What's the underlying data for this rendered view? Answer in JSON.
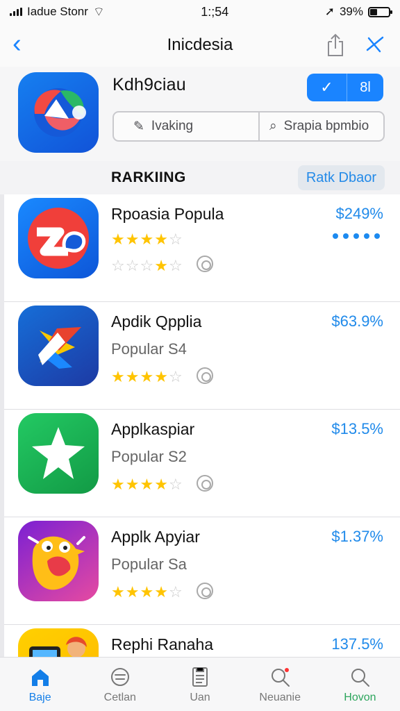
{
  "status": {
    "carrier": "Iadue Stonr",
    "time": "1:;54",
    "battery": "39%",
    "battery_level": 0.39
  },
  "nav": {
    "title": "Inicdesia",
    "back_icon": "back-chevron-icon",
    "share_icon": "share-icon",
    "close_icon": "close-icon"
  },
  "header": {
    "title": "Kdh9ciau",
    "action_count": "8l",
    "search_left": "Ivaking",
    "search_right": "Srapia bpmbio"
  },
  "section": {
    "title": "RARKIING",
    "rank_chip": "Ratk Dbaor"
  },
  "apps": [
    {
      "name": "Rpoasia Popula",
      "subtitle": "",
      "price": "$249%",
      "rating": 4.5,
      "icon": "red-circle-za-icon",
      "extra": "dots"
    },
    {
      "name": "Apdik Qpplia",
      "subtitle": "Popular S4",
      "price": "$63.9%",
      "rating": 4.5,
      "icon": "blue-geometric-icon"
    },
    {
      "name": "Applkaspiar",
      "subtitle": "Popular S2",
      "price": "$13.5%",
      "rating": 4.5,
      "icon": "green-star-icon"
    },
    {
      "name": "Applk Apyiar",
      "subtitle": "Popular Sa",
      "price": "$1.37%",
      "rating": 4.5,
      "icon": "cartoon-character-icon"
    },
    {
      "name": "Rephi Ranaha",
      "subtitle": "",
      "price": "137.5%",
      "rating": 0,
      "icon": "yellow-person-icon"
    }
  ],
  "tabs": [
    {
      "label": "Baje",
      "icon": "home-icon"
    },
    {
      "label": "Cetlan",
      "icon": "chat-icon"
    },
    {
      "label": "Uan",
      "icon": "document-icon"
    },
    {
      "label": "Neuanie",
      "icon": "search-notification-icon"
    },
    {
      "label": "Hovon",
      "icon": "search-icon"
    }
  ]
}
